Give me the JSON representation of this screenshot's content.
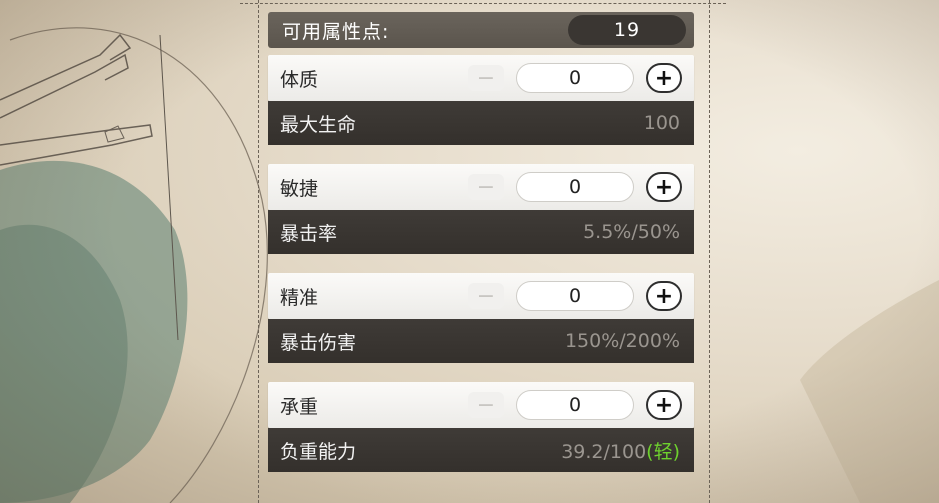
{
  "attribute_points": {
    "label": "可用属性点:",
    "value": "19"
  },
  "attributes": [
    {
      "name": "体质",
      "value": "0",
      "minus": "−",
      "plus": "+",
      "stat_name": "最大生命",
      "stat_value": "100",
      "stat_tag": ""
    },
    {
      "name": "敏捷",
      "value": "0",
      "minus": "−",
      "plus": "+",
      "stat_name": "暴击率",
      "stat_value": "5.5%/50%",
      "stat_tag": ""
    },
    {
      "name": "精准",
      "value": "0",
      "minus": "−",
      "plus": "+",
      "stat_name": "暴击伤害",
      "stat_value": "150%/200%",
      "stat_tag": ""
    },
    {
      "name": "承重",
      "value": "0",
      "minus": "−",
      "plus": "+",
      "stat_name": "负重能力",
      "stat_value": "39.2/100",
      "stat_tag": "(轻)"
    }
  ],
  "colors": {
    "light_tag": "#6ed12e",
    "dark_row": "#3a3632",
    "points_bar": "#625c54"
  }
}
